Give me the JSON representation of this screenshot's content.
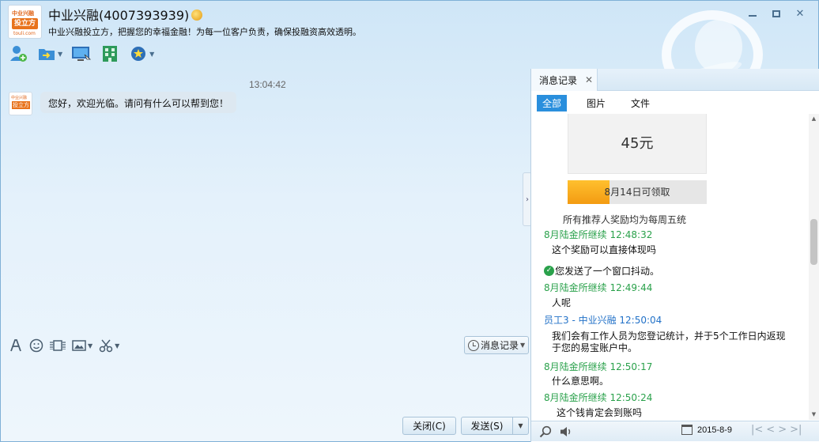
{
  "header": {
    "logo_top": "中业兴融",
    "logo_main": "投立方",
    "logo_url": "touli.com",
    "title": "中业兴融(4007393939)",
    "signature": "中业兴融投立方，把握您的幸福金融！为每一位客户负责，确保投融资高效透明。"
  },
  "window_controls": {
    "minimize": "minimize",
    "maximize": "maximize",
    "close": "✕"
  },
  "toolbar": {
    "icons": [
      "add-contact-icon",
      "send-file-icon",
      "remote-desktop-icon",
      "app-grid-icon",
      "more-apps-icon"
    ]
  },
  "chat": {
    "time": "13:04:42",
    "avatar_top": "中业兴融",
    "avatar_main": "投立方",
    "message": "您好，欢迎光临。请问有什么可以帮到您！"
  },
  "input_toolbar": {
    "history_label": "消息记录"
  },
  "buttons": {
    "close_label": "关闭(C)",
    "send_label": "发送(S)"
  },
  "panel": {
    "tab_label": "消息记录",
    "tab_close": "✕",
    "filters": [
      "全部",
      "图片",
      "文件"
    ],
    "card_amount": "45元",
    "progress_fraction": 0.3,
    "progress_text": "8月14日可领取",
    "card_note": "所有推荐人奖励均为每周五统",
    "records": [
      {
        "type": "customer",
        "name": "8月陆金所继续 12:48:32",
        "text": "这个奖励可以直接体现吗"
      },
      {
        "type": "system",
        "text": "您发送了一个窗口抖动。"
      },
      {
        "type": "customer",
        "name": "8月陆金所继续 12:49:44",
        "text": "人呢"
      },
      {
        "type": "staff",
        "name": "员工3 - 中业兴融 12:50:04",
        "text": "我们会有工作人员为您登记统计，并于5个工作日内返现于您的易宝账户中。"
      },
      {
        "type": "customer",
        "name": "8月陆金所继续 12:50:17",
        "text": "什么意思啊。"
      },
      {
        "type": "customer",
        "name": "8月陆金所继续 12:50:24",
        "text": "这个钱肯定会到账吗"
      }
    ],
    "date": "2015-8-9"
  }
}
